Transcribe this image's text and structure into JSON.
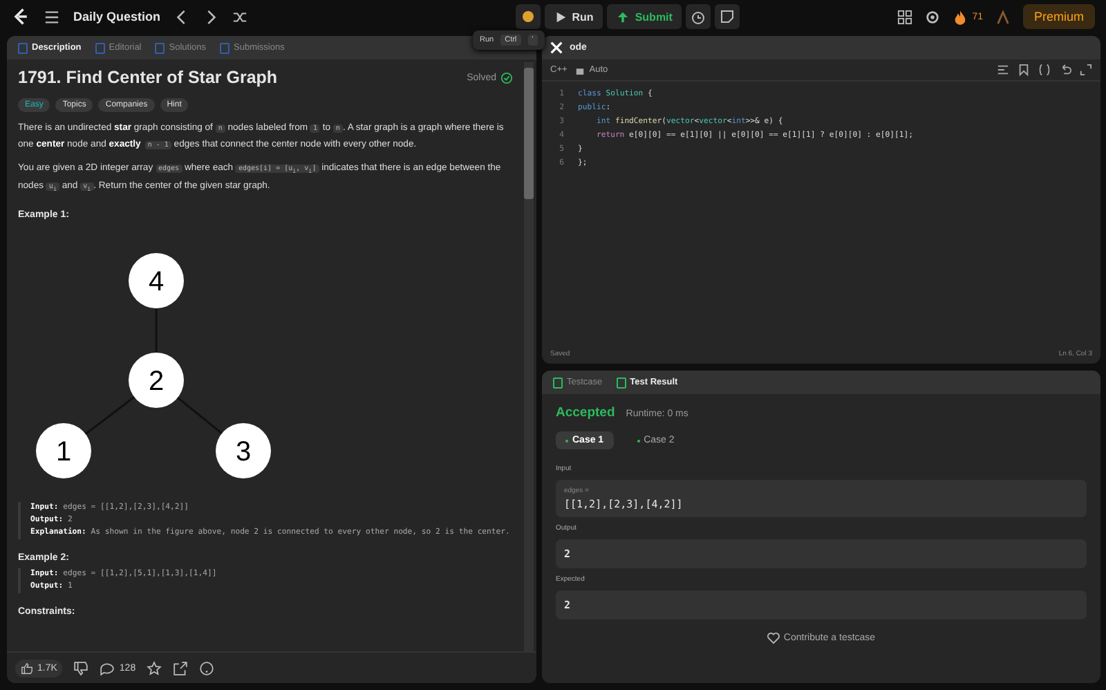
{
  "topbar": {
    "title": "Daily Question",
    "run": "Run",
    "submit": "Submit",
    "streak": "71",
    "premium": "Premium"
  },
  "tooltip": {
    "label": "Run",
    "keys": [
      "Ctrl",
      "'"
    ]
  },
  "left_tabs": [
    {
      "label": "Description",
      "selected": true
    },
    {
      "label": "Editorial",
      "selected": false
    },
    {
      "label": "Solutions",
      "selected": false
    },
    {
      "label": "Submissions",
      "selected": false
    }
  ],
  "problem": {
    "title": "1791. Find Center of Star Graph",
    "status": "Solved",
    "difficulty": "Easy",
    "chips": [
      "Topics",
      "Companies",
      "Hint"
    ],
    "paragraphs": [
      [
        {
          "kind": "plain",
          "s": "There is an undirected "
        },
        {
          "kind": "bold",
          "s": "star"
        },
        {
          "kind": "plain",
          "s": " graph consisting of "
        },
        {
          "kind": "code",
          "s": "n"
        },
        {
          "kind": "plain",
          "s": " nodes labeled from "
        },
        {
          "kind": "code",
          "s": "1"
        },
        {
          "kind": "plain",
          "s": " to "
        },
        {
          "kind": "code",
          "s": "n"
        },
        {
          "kind": "plain",
          "s": ". A star graph is a graph where there is one "
        },
        {
          "kind": "bold",
          "s": "center"
        },
        {
          "kind": "plain",
          "s": " node and "
        },
        {
          "kind": "bold",
          "s": "exactly"
        },
        {
          "kind": "code",
          "s": "n - 1"
        },
        {
          "kind": "plain",
          "s": " edges that connect the center node with every other node."
        }
      ],
      [
        {
          "kind": "plain",
          "s": "You are given a 2D integer array "
        },
        {
          "kind": "code",
          "s": "edges"
        },
        {
          "kind": "plain",
          "s": " where each "
        },
        {
          "kind": "code",
          "s": "edges[i] = [u$_{i}$, v$_{i}$]"
        },
        {
          "kind": "plain",
          "s": " indicates that there is an edge between the nodes "
        },
        {
          "kind": "code",
          "s": "u$_{i}$"
        },
        {
          "kind": "plain",
          "s": " and "
        },
        {
          "kind": "code",
          "s": "v$_{i}$"
        },
        {
          "kind": "plain",
          "s": ". Return the center of the given star graph."
        }
      ]
    ],
    "examples": [
      {
        "heading": "Example 1:",
        "graph": {
          "nodes": [
            {
              "label": "4"
            },
            {
              "label": "2"
            },
            {
              "label": "1"
            },
            {
              "label": "3"
            }
          ]
        },
        "lines": [
          {
            "key": "Input:",
            "value": "edges = [[1,2],[2,3],[4,2]]"
          },
          {
            "key": "Output:",
            "value": "2"
          },
          {
            "key": "Explanation:",
            "value": "As shown in the figure above, node 2 is connected to every other node, so 2 is the center."
          }
        ]
      },
      {
        "heading": "Example 2:",
        "lines": [
          {
            "key": "Input:",
            "value": "edges = [[1,2],[5,1],[1,3],[1,4]]"
          },
          {
            "key": "Output:",
            "value": "1"
          }
        ]
      }
    ],
    "constraints_heading": "Constraints:"
  },
  "footer": {
    "likes": "1.7K",
    "comments": "128"
  },
  "editor": {
    "title": "ode",
    "language": "C++",
    "mode": "Auto",
    "status": "Saved",
    "cursor": "Ln 6, Col 3",
    "lines": [
      {
        "number": "1",
        "tokens": [
          {
            "kind": "keyword",
            "s": "class "
          },
          {
            "kind": "type",
            "s": "Solution"
          },
          {
            "kind": "plain",
            "s": " {"
          }
        ]
      },
      {
        "number": "2",
        "tokens": [
          {
            "kind": "keyword",
            "s": "public"
          },
          {
            "kind": "plain",
            "s": ":"
          }
        ]
      },
      {
        "number": "3",
        "tokens": [
          {
            "kind": "keyword",
            "s": "    int "
          },
          {
            "kind": "function",
            "s": "findCenter"
          },
          {
            "kind": "plain",
            "s": "("
          },
          {
            "kind": "type",
            "s": "vector"
          },
          {
            "kind": "plain",
            "s": "<"
          },
          {
            "kind": "type",
            "s": "vector"
          },
          {
            "kind": "plain",
            "s": "<"
          },
          {
            "kind": "keyword",
            "s": "int"
          },
          {
            "kind": "plain",
            "s": ">>& e) {"
          }
        ]
      },
      {
        "number": "4",
        "tokens": [
          {
            "kind": "control",
            "s": "    return "
          },
          {
            "kind": "plain",
            "s": "e[0][0] == e[1][0] || e[0][0] == e[1][1] ? e[0][0] : e[0][1];"
          }
        ]
      },
      {
        "number": "5",
        "tokens": [
          {
            "kind": "plain",
            "s": "}"
          }
        ]
      },
      {
        "number": "6",
        "tokens": [
          {
            "kind": "plain",
            "s": "};"
          }
        ]
      }
    ]
  },
  "result_tabs": [
    {
      "label": "Testcase",
      "selected": false
    },
    {
      "label": "Test Result",
      "selected": true
    }
  ],
  "result": {
    "verdict": "Accepted",
    "runtime": "Runtime: 0 ms",
    "cases": [
      {
        "label": "Case 1",
        "selected": true
      },
      {
        "label": "Case 2",
        "selected": false
      }
    ],
    "input_label": "Input",
    "param": "edges =",
    "input": "[[1,2],[2,3],[4,2]]",
    "output_label": "Output",
    "output": "2",
    "expected_label": "Expected",
    "expected": "2",
    "contribute": "Contribute a testcase"
  }
}
